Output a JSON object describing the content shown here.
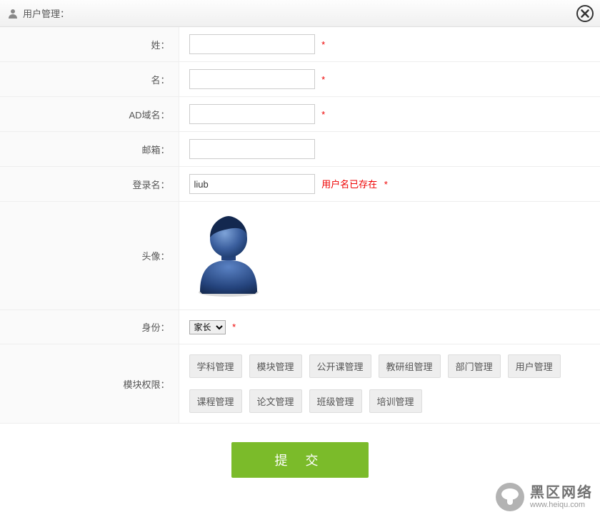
{
  "header": {
    "title": "用户管理："
  },
  "form": {
    "surname": {
      "label": "姓：",
      "value": "",
      "required": true
    },
    "given_name": {
      "label": "名：",
      "value": "",
      "required": true
    },
    "ad_domain": {
      "label": "AD域名：",
      "value": "",
      "required": true
    },
    "email": {
      "label": "邮箱：",
      "value": "",
      "required": false
    },
    "login": {
      "label": "登录名：",
      "value": "liub",
      "error": "用户名已存在",
      "required": true
    },
    "avatar": {
      "label": "头像："
    },
    "role": {
      "label": "身份：",
      "selected": "家长",
      "required": true
    },
    "permissions": {
      "label": "模块权限：",
      "row1": [
        "学科管理",
        "模块管理",
        "公开课管理",
        "教研组管理",
        "部门管理",
        "用户管理"
      ],
      "row2": [
        "课程管理",
        "论文管理",
        "班级管理",
        "培训管理"
      ]
    }
  },
  "submit_label": "提 交",
  "required_star": "*",
  "watermark": {
    "cn": "黑区网络",
    "en": "www.heiqu.com"
  }
}
